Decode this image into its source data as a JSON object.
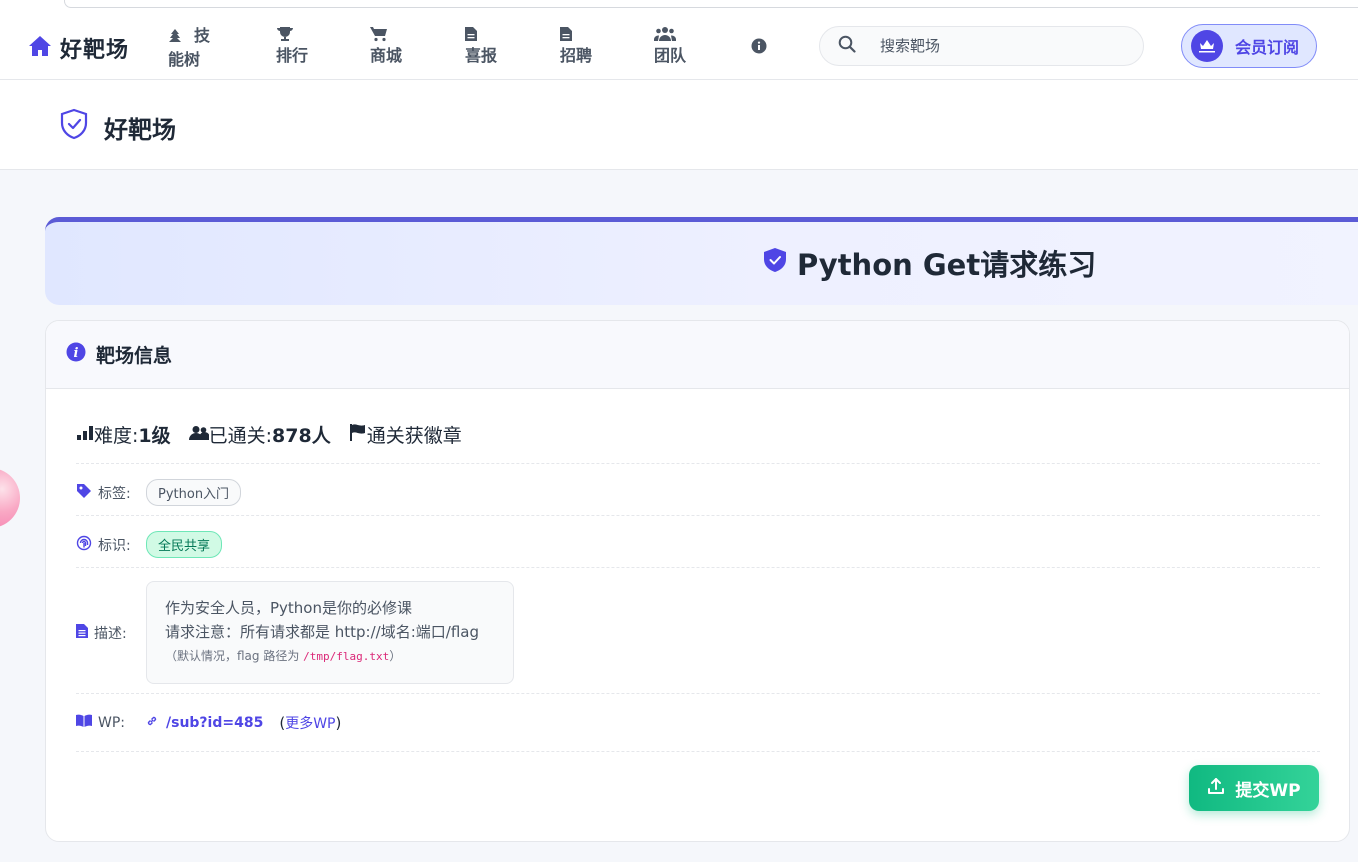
{
  "brand": {
    "name": "好靶场",
    "icon": "home-icon"
  },
  "nav": [
    {
      "label_line1": "技",
      "label_line2": "能树",
      "icon": "tree-icon"
    },
    {
      "label_line1": "",
      "label_line2": "排行",
      "icon": "trophy-icon"
    },
    {
      "label_line1": "",
      "label_line2": "商城",
      "icon": "cart-icon"
    },
    {
      "label_line1": "",
      "label_line2": "喜报",
      "icon": "document-icon"
    },
    {
      "label_line1": "",
      "label_line2": "招聘",
      "icon": "document-icon"
    },
    {
      "label_line1": "",
      "label_line2": "团队",
      "icon": "users-icon"
    },
    {
      "label_line1": "",
      "label_line2": "",
      "icon": "info-icon"
    }
  ],
  "search": {
    "placeholder": "搜索靶场"
  },
  "member": {
    "label": "会员订阅"
  },
  "page_header": {
    "title": "好靶场"
  },
  "banner": {
    "title": "Python Get请求练习"
  },
  "card": {
    "heading": "靶场信息",
    "stats": {
      "difficulty_label": "难度: ",
      "difficulty_value": "1级",
      "passed_label": "已通关: ",
      "passed_value": "878人",
      "badge_label": "通关获徽章"
    },
    "tags": {
      "label": "标签:",
      "items": [
        "Python入门"
      ]
    },
    "marks": {
      "label": "标识:",
      "items": [
        "全民共享"
      ]
    },
    "desc": {
      "label": "描述:",
      "line1": "作为安全人员，Python是你的必修课",
      "line2": "请求注意：所有请求都是 http://域名:端口/flag",
      "note_prefix": "（默认情况，flag 路径为 ",
      "note_path": "/tmp/flag.txt",
      "note_suffix": "）"
    },
    "wp": {
      "label": "WP:",
      "link": "/sub?id=485",
      "more_open": "(",
      "more_link": "更多WP",
      "more_close": ")"
    },
    "submit_label": "提交WP"
  },
  "colors": {
    "accent": "#4f46e5",
    "banner_border": "#5b5bd6",
    "success": "#10b981"
  }
}
